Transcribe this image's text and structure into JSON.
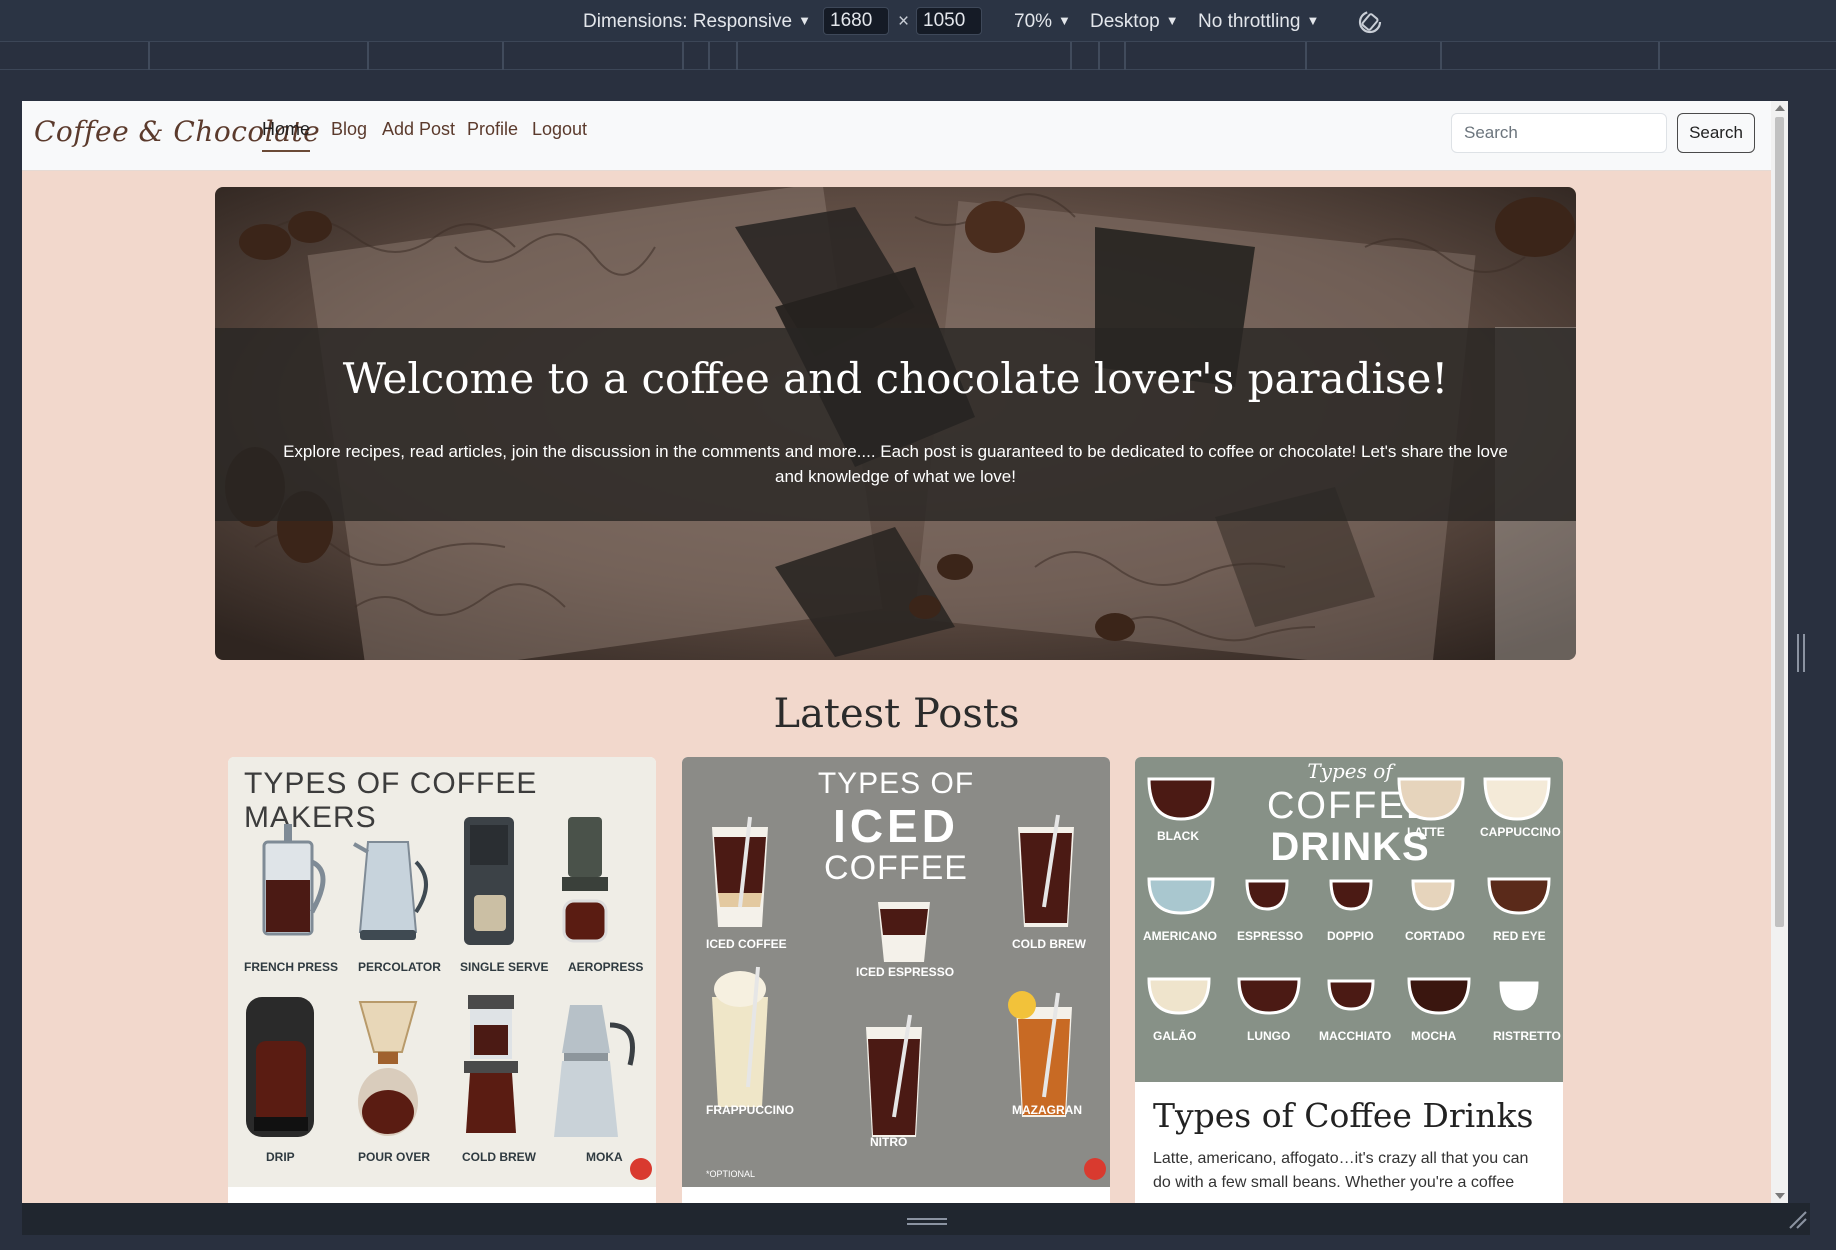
{
  "devtools": {
    "dimensions_label": "Dimensions: Responsive",
    "width_value": "1680",
    "height_value": "1050",
    "zoom": "70%",
    "device": "Desktop",
    "throttling": "No throttling",
    "times": "×"
  },
  "navbar": {
    "brand": "Coffee & Chocolate",
    "links": [
      "Home",
      "Blog",
      "Add Post",
      "Profile",
      "Logout"
    ],
    "search_placeholder": "Search",
    "search_button": "Search"
  },
  "hero": {
    "title": "Welcome to a coffee and chocolate lover's paradise!",
    "text": "Explore recipes, read articles, join the discussion in the comments and more.... Each post is guaranteed to be dedicated to coffee or chocolate! Let's share the love and knowledge of what we love!"
  },
  "latest": {
    "heading": "Latest Posts",
    "cards": [
      {
        "poster_title": "TYPES OF COFFEE MAKERS",
        "items": [
          "FRENCH PRESS",
          "PERCOLATOR",
          "SINGLE SERVE",
          "AEROPRESS",
          "DRIP",
          "POUR OVER",
          "COLD BREW",
          "MOKA"
        ]
      },
      {
        "poster_title_1": "TYPES OF",
        "poster_title_2": "ICED",
        "poster_title_3": "COFFEE",
        "items": [
          "ICED COFFEE",
          "ICED ESPRESSO",
          "COLD BREW",
          "FRAPPUCCINO",
          "NITRO",
          "MAZAGRAN"
        ],
        "footnote": "*OPTIONAL"
      },
      {
        "poster_title_1": "Types of",
        "poster_title_2": "COFFEE",
        "poster_title_3": "DRINKS",
        "items": [
          "BLACK",
          "LATTE",
          "CAPPUCCINO",
          "AMERICANO",
          "ESPRESSO",
          "DOPPIO",
          "CORTADO",
          "RED EYE",
          "GALÃO",
          "LUNGO",
          "MACCHIATO",
          "MOCHA",
          "RISTRETTO"
        ],
        "title": "Types of Coffee Drinks",
        "text": "Latte, americano, affogato…it's crazy all that you can do with a few small beans. Whether you're a coffee"
      }
    ]
  },
  "colors": {
    "page_bg": "#f2d8cc",
    "brand": "#5b3a2c",
    "devtools_bg": "#2b3444"
  }
}
